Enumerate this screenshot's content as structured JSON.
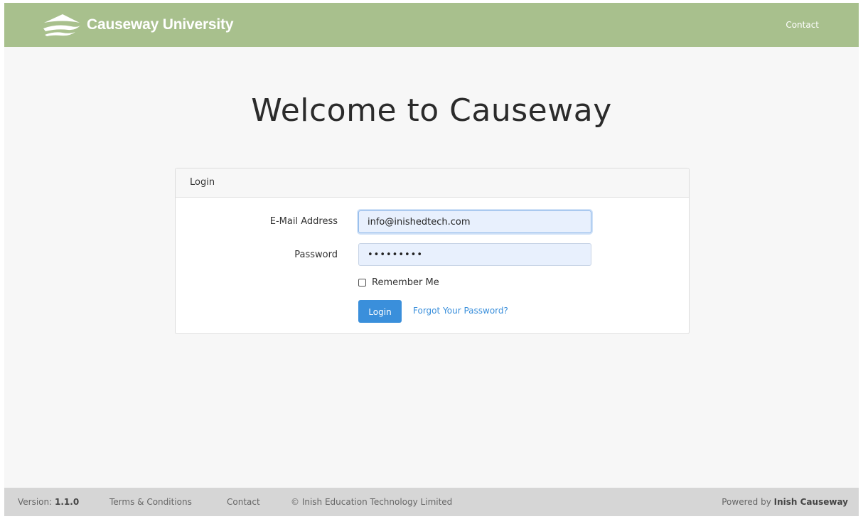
{
  "header": {
    "brand_name": "Causeway University",
    "contact_label": "Contact"
  },
  "main": {
    "welcome_title": "Welcome to Causeway"
  },
  "login_card": {
    "header_label": "Login",
    "email_label": "E-Mail Address",
    "email_value": "info@inishedtech.com",
    "password_label": "Password",
    "password_value": "•••••••••",
    "remember_label": "Remember Me",
    "remember_checked": false,
    "login_button_label": "Login",
    "forgot_label": "Forgot Your Password?"
  },
  "footer": {
    "version_prefix": "Version:",
    "version_number": "1.1.0",
    "terms_label": "Terms & Conditions",
    "contact_label": "Contact",
    "copyright": "© Inish Education Technology Limited",
    "powered_prefix": "Powered by",
    "powered_name": "Inish Causeway"
  },
  "colors": {
    "navbar": "#a8c08d",
    "primary_button": "#3a8fdb",
    "link": "#3a8fdb",
    "input_background": "#e8f0fd",
    "footer": "#d6d6d6",
    "page_background": "#f7f7f7"
  }
}
